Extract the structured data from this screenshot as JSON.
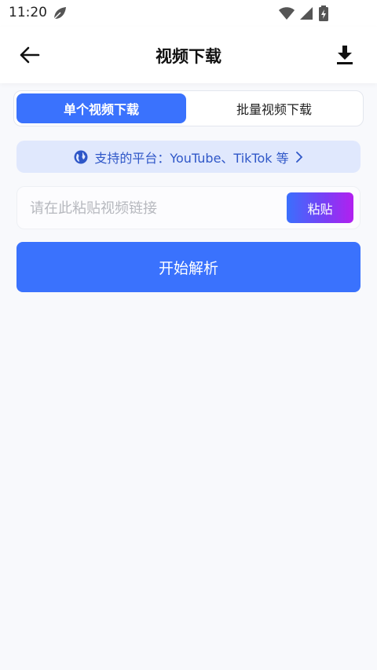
{
  "status_bar": {
    "time": "11:20"
  },
  "header": {
    "title": "视频下载"
  },
  "tabs": [
    {
      "label": "单个视频下载",
      "active": true
    },
    {
      "label": "批量视频下载",
      "active": false
    }
  ],
  "banner": {
    "text": "支持的平台：YouTube、TikTok 等"
  },
  "link_input": {
    "placeholder": "请在此粘贴视频链接",
    "value": ""
  },
  "paste_button": {
    "label": "粘贴"
  },
  "parse_button": {
    "label": "开始解析"
  },
  "colors": {
    "accent": "#3a72fd",
    "banner_bg": "#e0e8fd",
    "banner_text": "#2f57c8",
    "paste_gradient": [
      "#3a6ffd",
      "#b320ef"
    ]
  },
  "icons": {
    "back": "arrow-left-icon",
    "download": "download-icon",
    "banner": "globe-icon",
    "banner_arrow": "chevron-right-icon",
    "status_leaf": "leaf-icon",
    "status_wifi": "wifi-icon",
    "status_signal": "signal-icon",
    "status_battery": "battery-icon"
  }
}
